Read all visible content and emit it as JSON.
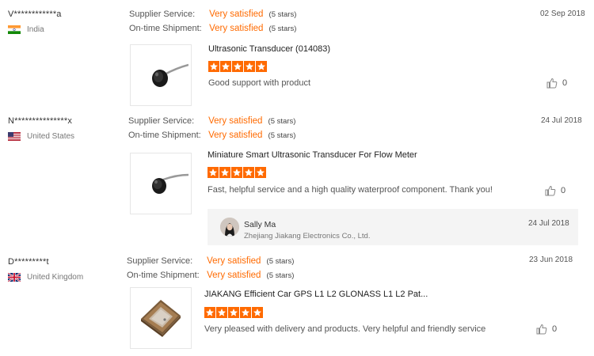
{
  "reviews": [
    {
      "buyer": "V************a",
      "country": "India",
      "supplier_label": "Supplier Service:",
      "supplier_value": "Very satisfied",
      "supplier_stars": "(5 stars)",
      "shipment_label": "On-time Shipment:",
      "shipment_value": "Very satisfied",
      "shipment_stars": "(5 stars)",
      "date": "02 Sep 2018",
      "product_title": "Ultrasonic Transducer (014083)",
      "rating": 5,
      "comment": "Good support with product",
      "likes": "0"
    },
    {
      "buyer": "N***************x",
      "country": "United States",
      "supplier_label": "Supplier Service:",
      "supplier_value": "Very satisfied",
      "supplier_stars": "(5 stars)",
      "shipment_label": "On-time Shipment:",
      "shipment_value": "Very satisfied",
      "shipment_stars": "(5 stars)",
      "date": "24 Jul 2018",
      "product_title": "Miniature Smart Ultrasonic Transducer For Flow Meter",
      "rating": 5,
      "comment": "Fast, helpful service and a high quality waterproof component. Thank you!",
      "likes": "0",
      "reply": {
        "name": "Sally Ma",
        "company": "Zhejiang Jiakang Electronics Co., Ltd.",
        "date": "24 Jul 2018"
      }
    },
    {
      "buyer": "D*********t",
      "country": "United Kingdom",
      "supplier_label": "Supplier Service:",
      "supplier_value": "Very satisfied",
      "supplier_stars": "(5 stars)",
      "shipment_label": "On-time Shipment:",
      "shipment_value": "Very satisfied",
      "shipment_stars": "(5 stars)",
      "date": "23 Jun 2018",
      "product_title": "JIAKANG Efficient Car GPS L1 L2 GLONASS L1 L2 Pat...",
      "rating": 5,
      "comment": "Very pleased with delivery and products. Very helpful and friendly service",
      "likes": "0"
    }
  ],
  "colors": {
    "accent": "#ff6a00",
    "reply_bg": "#f4f4f4"
  },
  "icons": {
    "like": "thumbs-up-icon",
    "star": "star-icon"
  }
}
